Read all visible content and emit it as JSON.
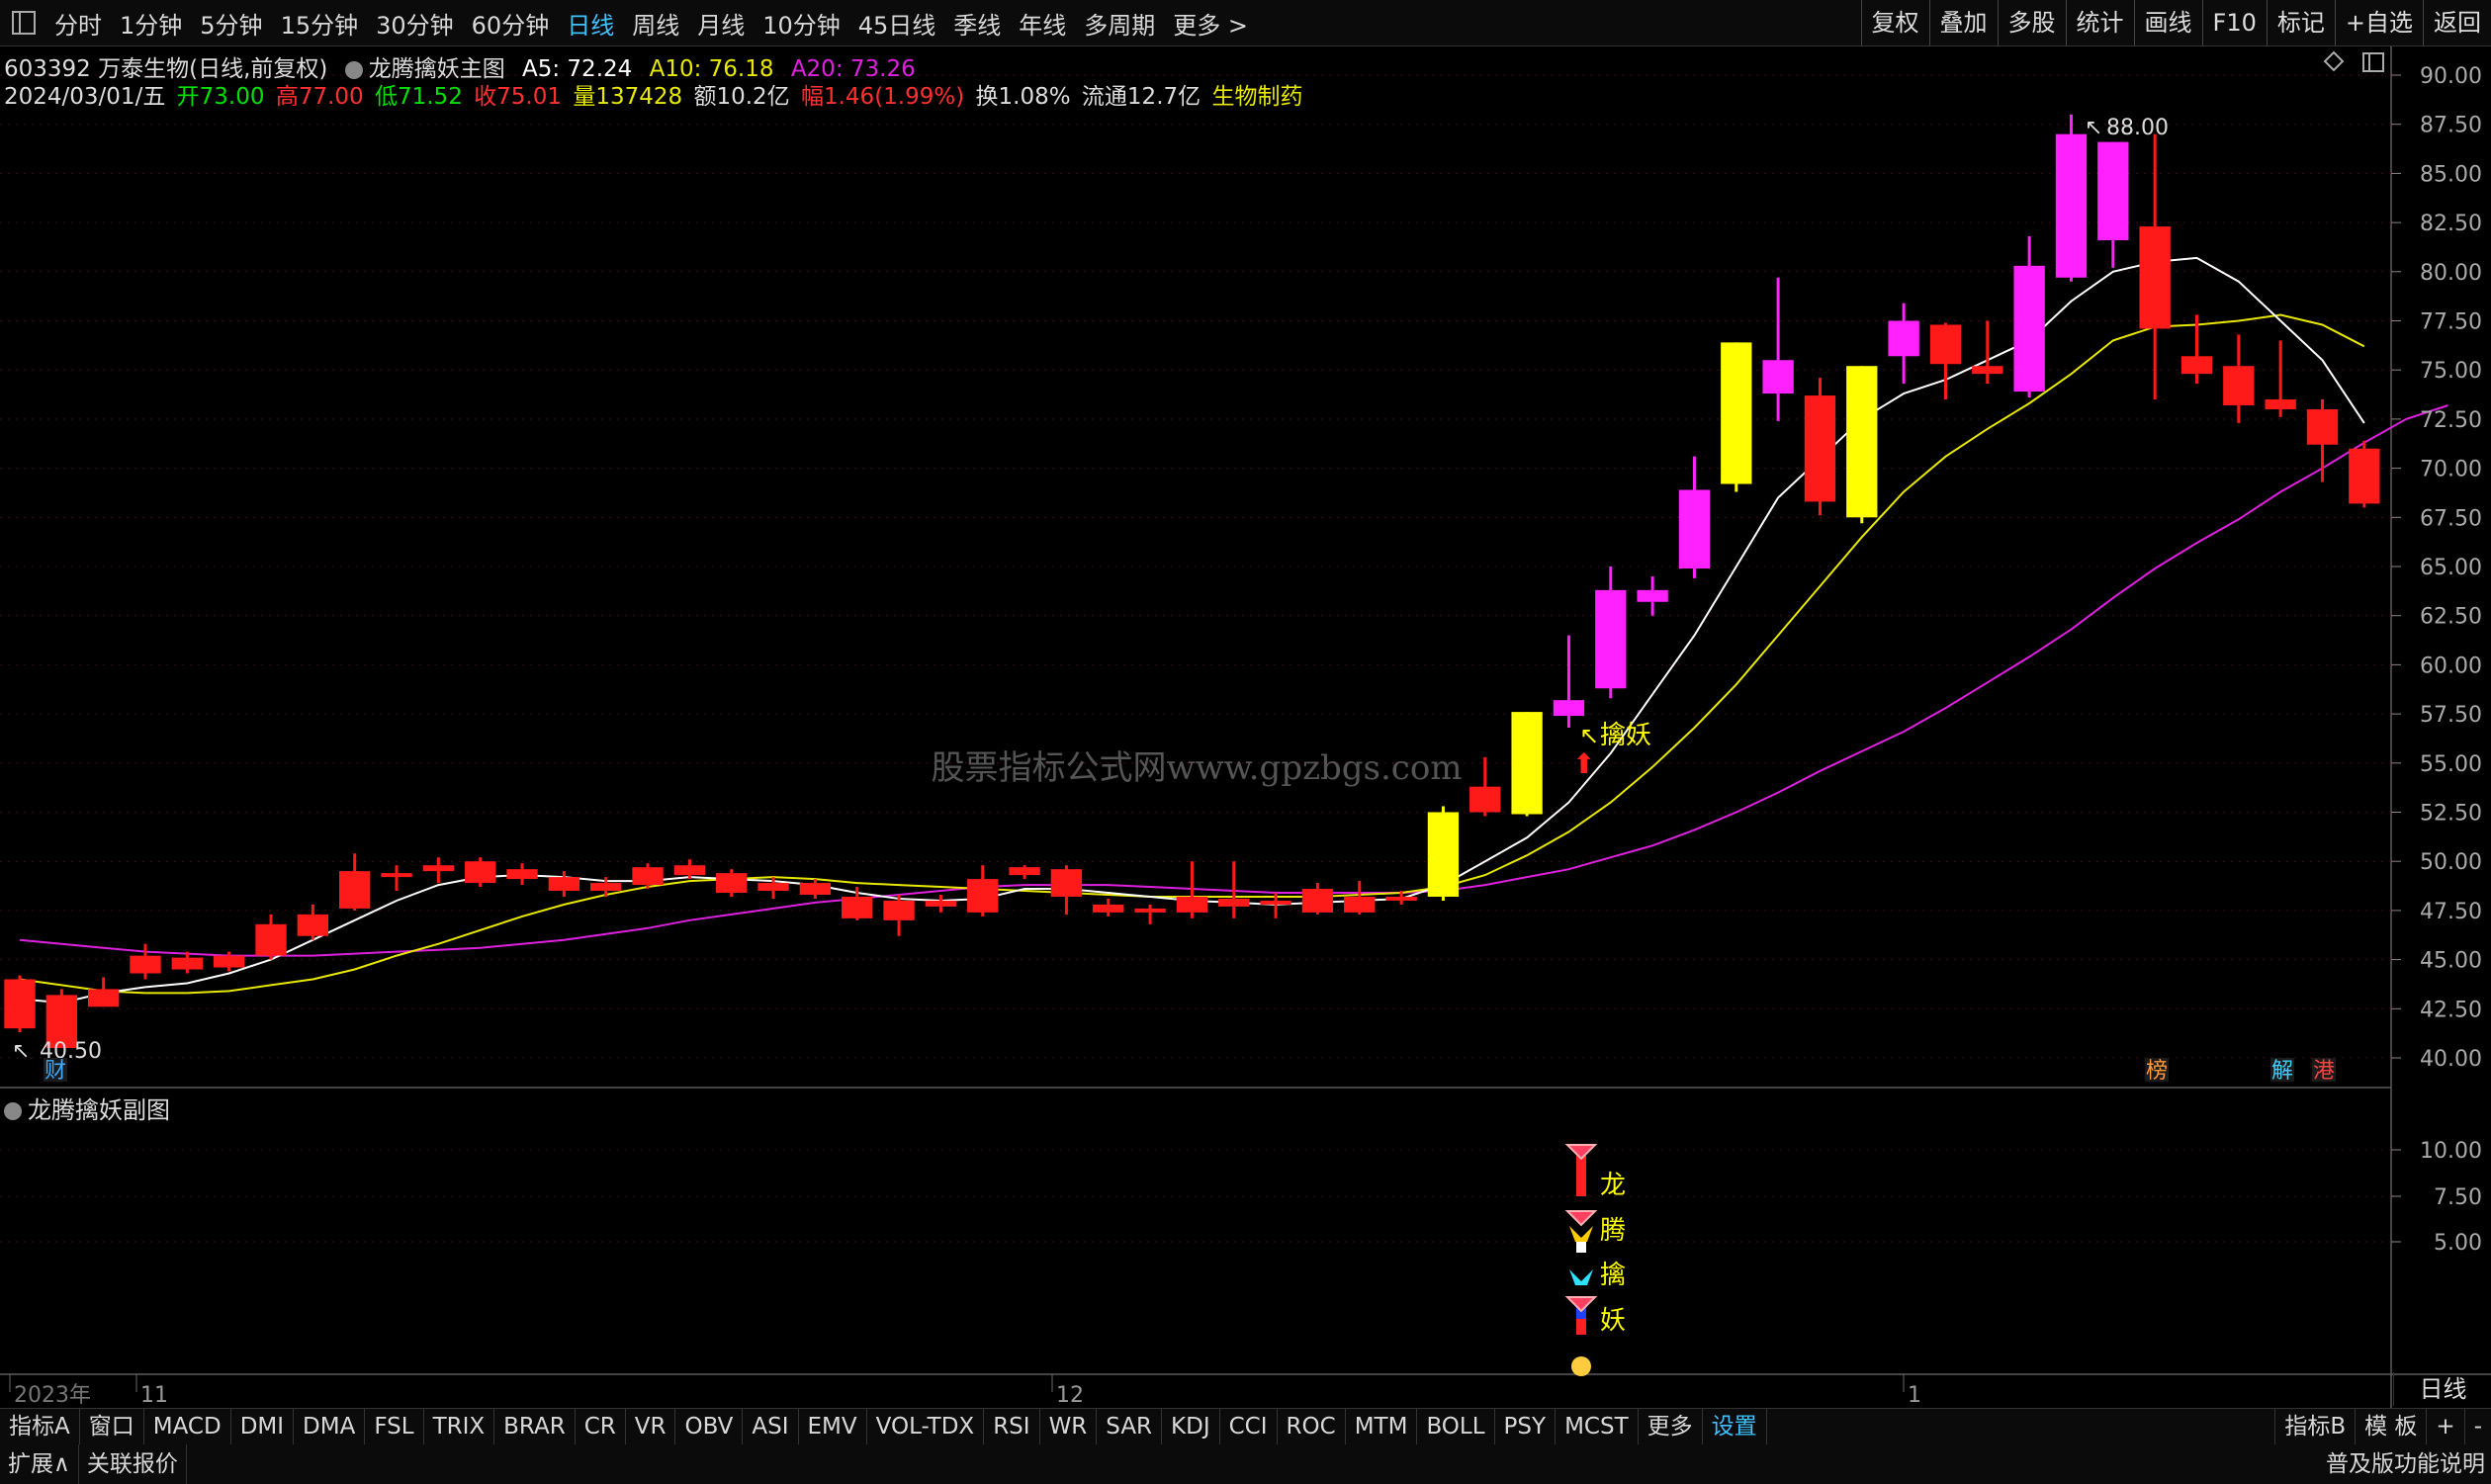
{
  "toolbar": {
    "periods": [
      "分时",
      "1分钟",
      "5分钟",
      "15分钟",
      "30分钟",
      "60分钟",
      "日线",
      "周线",
      "月线",
      "10分钟",
      "45日线",
      "季线",
      "年线",
      "多周期",
      "更多 >"
    ],
    "active_period": "日线",
    "right_buttons": [
      "复权",
      "叠加",
      "多股",
      "统计",
      "画线",
      "F10",
      "标记",
      "+自选",
      "返回"
    ]
  },
  "stock": {
    "code_name": "603392 万泰生物(日线,前复权)",
    "indicator_name": "龙腾擒妖主图",
    "a5": "A5: 72.24",
    "a10": "A10: 76.18",
    "a20": "A20: 73.26",
    "date": "2024/03/01/五",
    "open": "开73.00",
    "high": "高77.00",
    "low": "低71.52",
    "close": "收75.01",
    "volume": "量137428",
    "amount": "额10.2亿",
    "change": "幅1.46(1.99%)",
    "turnover": "换1.08%",
    "float_cap": "流通12.7亿",
    "sector": "生物制药"
  },
  "sub_chart": {
    "label": "龙腾擒妖副图",
    "chars": [
      "龙",
      "腾",
      "擒",
      "妖"
    ],
    "y_ticks": [
      "10.00",
      "7.50",
      "5.00"
    ]
  },
  "main_chart": {
    "y_ticks": [
      "90.00",
      "87.50",
      "85.00",
      "82.50",
      "80.00",
      "77.50",
      "75.00",
      "72.50",
      "70.00",
      "67.50",
      "65.00",
      "62.50",
      "60.00",
      "57.50",
      "55.00",
      "52.50",
      "50.00",
      "47.50",
      "45.00",
      "42.50",
      "40.00"
    ],
    "high_label": "88.00",
    "low_label": "40.50",
    "signal_label": "擒妖",
    "watermark": "股票指标公式网www.gpzbgs.com",
    "markers": [
      {
        "text": "财",
        "color": "#3fa9ff"
      },
      {
        "text": "榜",
        "color": "#ff9a3c"
      },
      {
        "text": "解",
        "color": "#3fd0ff"
      },
      {
        "text": "港",
        "color": "#ff4040"
      }
    ],
    "x_labels": [
      "2023年",
      "11",
      "12",
      "1"
    ]
  },
  "colors": {
    "up": "#ff1a1a",
    "down": "#00c8c8",
    "yellow": "#ffff00",
    "magenta": "#ff22ff",
    "ma5": "#ffffff",
    "ma10": "#e8e800",
    "ma20": "#e020e0"
  },
  "bottom_tabs": [
    "指标A",
    "窗口",
    "MACD",
    "DMI",
    "DMA",
    "FSL",
    "TRIX",
    "BRAR",
    "CR",
    "VR",
    "OBV",
    "ASI",
    "EMV",
    "VOL-TDX",
    "RSI",
    "WR",
    "SAR",
    "KDJ",
    "CCI",
    "ROC",
    "MTM",
    "BOLL",
    "PSY",
    "MCST",
    "更多",
    "设置"
  ],
  "bottom_right": [
    "指标B",
    "模 板",
    "+",
    "-"
  ],
  "period_label": "日线",
  "status": {
    "expand": "扩展∧",
    "quote": "关联报价",
    "right": "普及版功能说明"
  },
  "chart_data": {
    "type": "candlestick",
    "ylim": [
      40,
      90
    ],
    "candles": [
      [
        44.0,
        41.5,
        44.2,
        41.3,
        "r"
      ],
      [
        43.2,
        40.5,
        43.5,
        40.5,
        "r"
      ],
      [
        43.5,
        42.6,
        44.1,
        42.6,
        "r"
      ],
      [
        45.2,
        44.3,
        45.8,
        44.0,
        "r"
      ],
      [
        45.1,
        44.5,
        45.4,
        44.3,
        "r"
      ],
      [
        45.2,
        44.6,
        45.4,
        44.4,
        "r"
      ],
      [
        46.8,
        45.2,
        47.3,
        45.0,
        "r"
      ],
      [
        47.3,
        46.2,
        47.8,
        46.0,
        "r"
      ],
      [
        49.5,
        47.6,
        50.4,
        47.5,
        "r"
      ],
      [
        49.4,
        49.2,
        49.8,
        48.5,
        "r"
      ],
      [
        49.8,
        49.5,
        50.2,
        48.9,
        "r"
      ],
      [
        50.0,
        48.9,
        50.2,
        48.7,
        "r"
      ],
      [
        49.6,
        49.1,
        49.9,
        48.8,
        "r"
      ],
      [
        49.2,
        48.5,
        49.5,
        48.2,
        "r"
      ],
      [
        48.9,
        48.5,
        49.2,
        48.2,
        "r"
      ],
      [
        49.7,
        48.8,
        49.9,
        48.6,
        "r"
      ],
      [
        49.8,
        49.3,
        50.1,
        49.1,
        "r"
      ],
      [
        49.4,
        48.4,
        49.6,
        48.2,
        "r"
      ],
      [
        48.9,
        48.5,
        49.2,
        48.1,
        "r"
      ],
      [
        48.9,
        48.3,
        49.1,
        48.1,
        "r"
      ],
      [
        48.2,
        47.1,
        48.7,
        47.0,
        "r"
      ],
      [
        48.0,
        47.0,
        48.3,
        46.2,
        "r"
      ],
      [
        48.0,
        47.7,
        48.3,
        47.4,
        "r"
      ],
      [
        49.1,
        47.4,
        49.8,
        47.2,
        "r"
      ],
      [
        49.7,
        49.3,
        49.8,
        49.1,
        "r"
      ],
      [
        49.6,
        48.2,
        49.8,
        47.3,
        "r"
      ],
      [
        47.8,
        47.4,
        48.1,
        47.2,
        "r"
      ],
      [
        47.6,
        47.4,
        47.8,
        46.8,
        "r"
      ],
      [
        48.2,
        47.4,
        50.0,
        47.1,
        "r"
      ],
      [
        48.1,
        47.7,
        50.0,
        47.1,
        "r"
      ],
      [
        48.0,
        47.8,
        48.4,
        47.1,
        "r"
      ],
      [
        48.6,
        47.4,
        48.9,
        47.3,
        "r"
      ],
      [
        48.2,
        47.4,
        49.0,
        47.3,
        "r"
      ],
      [
        48.2,
        48.0,
        48.5,
        47.8,
        "r"
      ],
      [
        52.5,
        48.2,
        52.8,
        48.0,
        "y"
      ],
      [
        53.8,
        52.5,
        55.3,
        52.3,
        "r"
      ],
      [
        57.6,
        52.4,
        57.6,
        52.3,
        "y"
      ],
      [
        58.2,
        57.4,
        61.5,
        56.8,
        "m"
      ],
      [
        63.8,
        58.8,
        65.0,
        58.3,
        "m"
      ],
      [
        63.8,
        63.2,
        64.5,
        62.5,
        "m"
      ],
      [
        68.9,
        64.9,
        70.6,
        64.4,
        "m"
      ],
      [
        76.4,
        69.2,
        76.4,
        68.8,
        "y"
      ],
      [
        75.5,
        73.8,
        79.7,
        72.4,
        "m"
      ],
      [
        73.7,
        68.3,
        74.6,
        67.6,
        "r"
      ],
      [
        75.2,
        67.5,
        75.2,
        67.2,
        "y"
      ],
      [
        77.5,
        75.7,
        78.4,
        74.3,
        "m"
      ],
      [
        77.3,
        75.3,
        77.4,
        73.5,
        "r"
      ],
      [
        75.2,
        74.8,
        77.5,
        74.3,
        "r"
      ],
      [
        80.3,
        73.9,
        81.8,
        73.6,
        "m"
      ],
      [
        87.0,
        79.7,
        88.0,
        79.5,
        "m"
      ],
      [
        86.6,
        81.6,
        86.6,
        80.2,
        "m"
      ],
      [
        82.3,
        77.1,
        87.0,
        73.5,
        "r"
      ],
      [
        75.7,
        74.8,
        77.8,
        74.3,
        "r"
      ],
      [
        75.2,
        73.2,
        76.8,
        72.3,
        "r"
      ],
      [
        73.5,
        73.0,
        76.5,
        72.6,
        "r"
      ],
      [
        73.0,
        71.2,
        73.5,
        69.3,
        "r"
      ],
      [
        71.0,
        68.2,
        71.4,
        68.0,
        "r"
      ]
    ],
    "ma5": [
      43.0,
      42.8,
      43.3,
      43.6,
      43.8,
      44.3,
      45.0,
      46.0,
      47.0,
      48.0,
      48.8,
      49.2,
      49.3,
      49.2,
      49.0,
      49.0,
      49.2,
      49.1,
      49.0,
      48.8,
      48.4,
      48.1,
      48.0,
      48.1,
      48.6,
      48.6,
      48.4,
      48.2,
      48.0,
      47.9,
      47.8,
      47.9,
      48.0,
      48.1,
      48.8,
      50.0,
      51.2,
      53.0,
      55.5,
      58.5,
      61.5,
      65.0,
      68.5,
      70.5,
      72.5,
      73.8,
      74.5,
      75.5,
      76.5,
      78.5,
      80.0,
      80.5,
      80.7,
      79.5,
      77.5,
      75.5,
      72.3
    ],
    "ma10": [
      44.0,
      43.7,
      43.4,
      43.3,
      43.3,
      43.4,
      43.7,
      44.0,
      44.5,
      45.2,
      45.8,
      46.5,
      47.2,
      47.8,
      48.3,
      48.7,
      49.0,
      49.1,
      49.2,
      49.1,
      48.9,
      48.8,
      48.7,
      48.6,
      48.5,
      48.4,
      48.3,
      48.2,
      48.2,
      48.2,
      48.2,
      48.2,
      48.3,
      48.4,
      48.7,
      49.3,
      50.3,
      51.5,
      53.0,
      54.8,
      56.8,
      59.0,
      61.5,
      64.0,
      66.5,
      68.8,
      70.6,
      72.0,
      73.3,
      74.8,
      76.5,
      77.2,
      77.3,
      77.5,
      77.8,
      77.3,
      76.2
    ],
    "ma20": [
      46.0,
      45.8,
      45.6,
      45.4,
      45.3,
      45.2,
      45.2,
      45.2,
      45.3,
      45.4,
      45.5,
      45.6,
      45.8,
      46.0,
      46.3,
      46.6,
      47.0,
      47.3,
      47.6,
      47.9,
      48.1,
      48.3,
      48.5,
      48.7,
      48.8,
      48.8,
      48.8,
      48.7,
      48.6,
      48.5,
      48.4,
      48.4,
      48.4,
      48.4,
      48.5,
      48.8,
      49.2,
      49.6,
      50.2,
      50.8,
      51.6,
      52.5,
      53.5,
      54.6,
      55.6,
      56.6,
      57.8,
      59.1,
      60.4,
      61.8,
      63.4,
      64.9,
      66.2,
      67.4,
      68.8,
      70.0,
      71.3,
      72.5,
      73.2
    ]
  }
}
